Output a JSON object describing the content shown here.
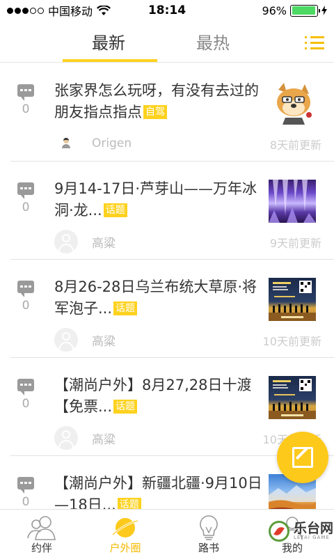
{
  "status_bar": {
    "carrier": "中国移动",
    "time": "18:14",
    "battery": "96%",
    "battery_level": 0.96,
    "signal_bars": 3
  },
  "tabs": [
    {
      "label": "最新",
      "active": true
    },
    {
      "label": "最热",
      "active": false
    }
  ],
  "menu_icon": "list-menu-icon",
  "feed": [
    {
      "comments": "0",
      "title": "张家界怎么玩呀，有没有去过的朋友指点指点",
      "tag": "自驾",
      "author": "Origen",
      "updated": "8天前更新",
      "thumb": "cartoon-dog-image"
    },
    {
      "comments": "0",
      "title": "9月14-17日·芦芽山——万年冰洞·龙...",
      "tag": "话题",
      "author": "高粱",
      "updated": "9天前更新",
      "thumb": "ice-cave-image"
    },
    {
      "comments": "0",
      "title": "8月26-28日乌兰布统大草原·将军泡子...",
      "tag": "话题",
      "author": "高粱",
      "updated": "10天前更新",
      "thumb": "hiking-poster-image"
    },
    {
      "comments": "0",
      "title": "【潮尚户外】8月27,28日十渡【免票...",
      "tag": "话题",
      "author": "高粱",
      "updated": "10天前更新",
      "thumb": "hiking-poster-image"
    },
    {
      "comments": "0",
      "title": "【潮尚户外】新疆北疆·9月10日—18日...",
      "tag": "话题",
      "author": "",
      "updated": "",
      "thumb": "xinjiang-landscape-image"
    }
  ],
  "bottom_nav": [
    {
      "label": "约伴",
      "icon": "people-icon",
      "active": false
    },
    {
      "label": "户外圈",
      "icon": "planet-icon",
      "active": true
    },
    {
      "label": "路书",
      "icon": "lightbulb-icon",
      "active": false
    },
    {
      "label": "我的",
      "icon": "user-icon",
      "active": false
    }
  ],
  "watermark": {
    "text": "乐台网",
    "sub": "LETAI GAME"
  },
  "colors": {
    "accent": "#fdd21f",
    "fab": "#fdc91b",
    "text": "#333333",
    "muted": "#aaaaaa"
  }
}
